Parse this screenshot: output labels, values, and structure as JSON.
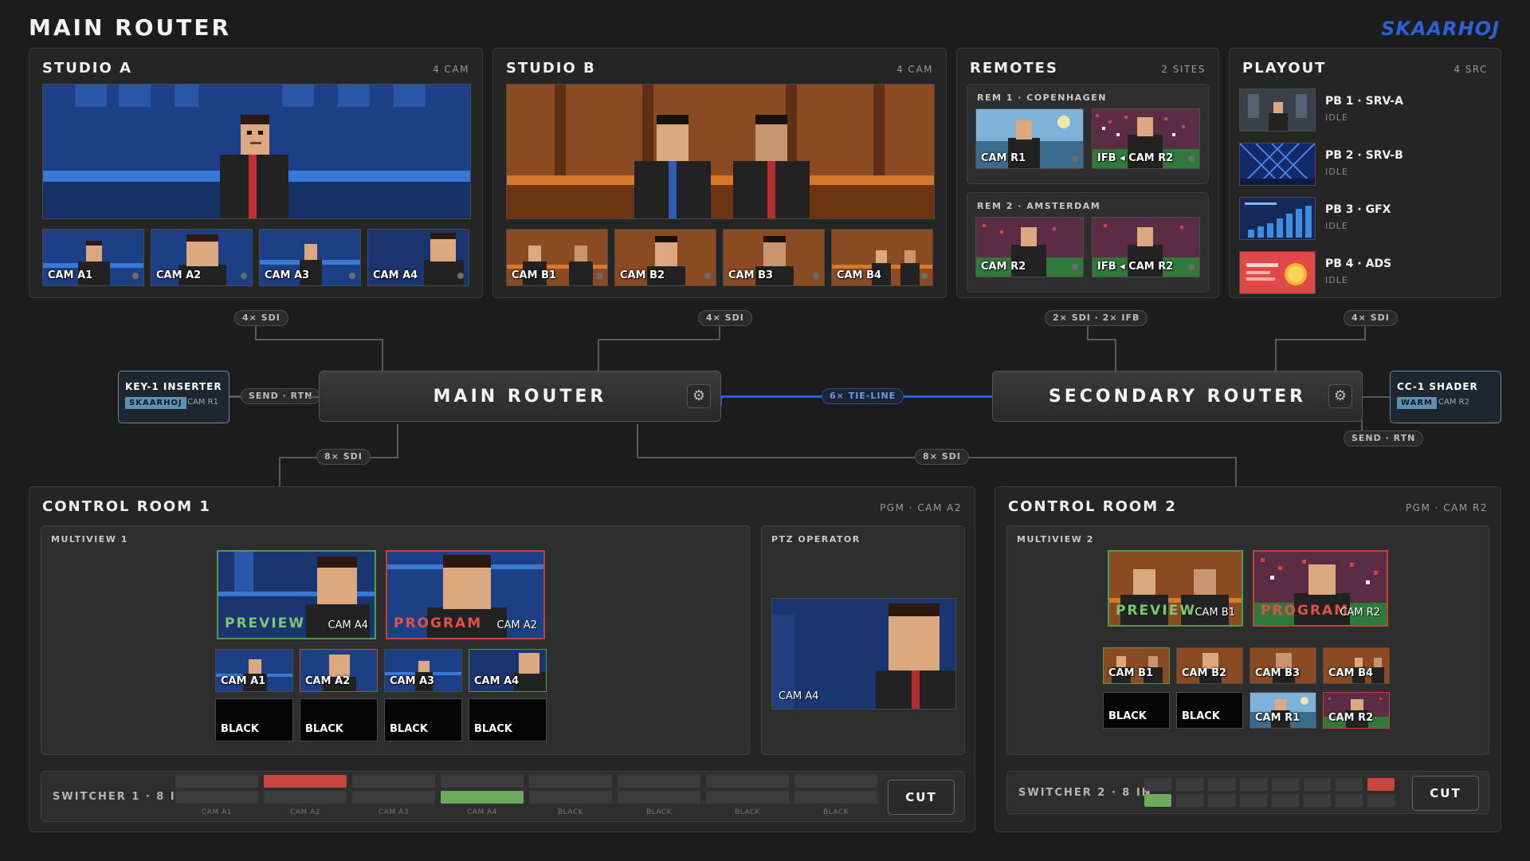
{
  "page": {
    "title": "MAIN ROUTER",
    "logo": "SKAARHOJ"
  },
  "studio_a": {
    "title": "STUDIO A",
    "meta": "4 CAM",
    "cams": [
      "CAM A1",
      "CAM A2",
      "CAM A3",
      "CAM A4"
    ]
  },
  "studio_b": {
    "title": "STUDIO B",
    "meta": "4 CAM",
    "cams": [
      "CAM B1",
      "CAM B2",
      "CAM B3",
      "CAM B4"
    ]
  },
  "remotes": {
    "title": "REMOTES",
    "meta": "2 SITES",
    "sites": [
      {
        "name": "REM 1 · COPENHAGEN",
        "feeds": [
          "CAM R1",
          "IFB ◂ CAM R2"
        ]
      },
      {
        "name": "REM 2 · AMSTERDAM",
        "feeds": [
          "CAM R2",
          "IFB ◂ CAM R2"
        ]
      }
    ]
  },
  "playout": {
    "title": "PLAYOUT",
    "meta": "4 SRC",
    "items": [
      {
        "name": "PB 1 · SRV-A",
        "status": "IDLE"
      },
      {
        "name": "PB 2 · SRV-B",
        "status": "IDLE"
      },
      {
        "name": "PB 3 · GFX",
        "status": "IDLE"
      },
      {
        "name": "PB 4 · ADS",
        "status": "IDLE"
      }
    ]
  },
  "links": {
    "studio_a": "4× SDI",
    "studio_b": "4× SDI",
    "remotes": "2× SDI · 2× IFB",
    "playout": "4× SDI",
    "tie_line": "6× TIE-LINE",
    "cr1": "8× SDI",
    "cr2": "8× SDI",
    "send_rtn_left": "SEND · RTN",
    "send_rtn_right": "SEND · RTN"
  },
  "routers": {
    "main": "MAIN ROUTER",
    "secondary": "SECONDARY ROUTER"
  },
  "devices": {
    "key": {
      "name": "KEY-1 INSERTER",
      "tag": "SKAARHOJ",
      "source": "CAM R1"
    },
    "shader": {
      "name": "CC-1 SHADER",
      "tag": "WARM",
      "source": "CAM R2"
    }
  },
  "cr1": {
    "title": "CONTROL ROOM 1",
    "meta": "PGM · CAM A2",
    "multiview": "MULTIVIEW 1",
    "preview_label": "PREVIEW",
    "preview_cam": "CAM A4",
    "program_label": "PROGRAM",
    "program_cam": "CAM A2",
    "grid": [
      "CAM A1",
      "CAM A2",
      "CAM A3",
      "CAM A4",
      "BLACK",
      "BLACK",
      "BLACK",
      "BLACK"
    ],
    "ptz_title": "PTZ OPERATOR",
    "ptz_cam": "CAM A4",
    "switcher_title": "SWITCHER 1 · 8 IN",
    "inputs": [
      "CAM A1",
      "CAM A2",
      "CAM A3",
      "CAM A4",
      "BLACK",
      "BLACK",
      "BLACK",
      "BLACK"
    ],
    "program_index": 1,
    "preview_index": 3,
    "cut_label": "CUT"
  },
  "cr2": {
    "title": "CONTROL ROOM 2",
    "meta": "PGM · CAM R2",
    "multiview": "MULTIVIEW 2",
    "preview_label": "PREVIEW",
    "preview_cam": "CAM B1",
    "program_label": "PROGRAM",
    "program_cam": "CAM R2",
    "grid": [
      "CAM B1",
      "CAM B2",
      "CAM B3",
      "CAM B4",
      "BLACK",
      "BLACK",
      "CAM R1",
      "CAM R2"
    ],
    "switcher_title": "SWITCHER 2 · 8 IN",
    "program_index": 7,
    "preview_index": 0,
    "cut_label": "CUT"
  },
  "icons": {
    "gear": "gear-icon"
  },
  "colors": {
    "program": "#c9463e",
    "preview": "#6cab5e",
    "tie_line": "#2e5fd8",
    "logo": "#2e5fd8"
  }
}
